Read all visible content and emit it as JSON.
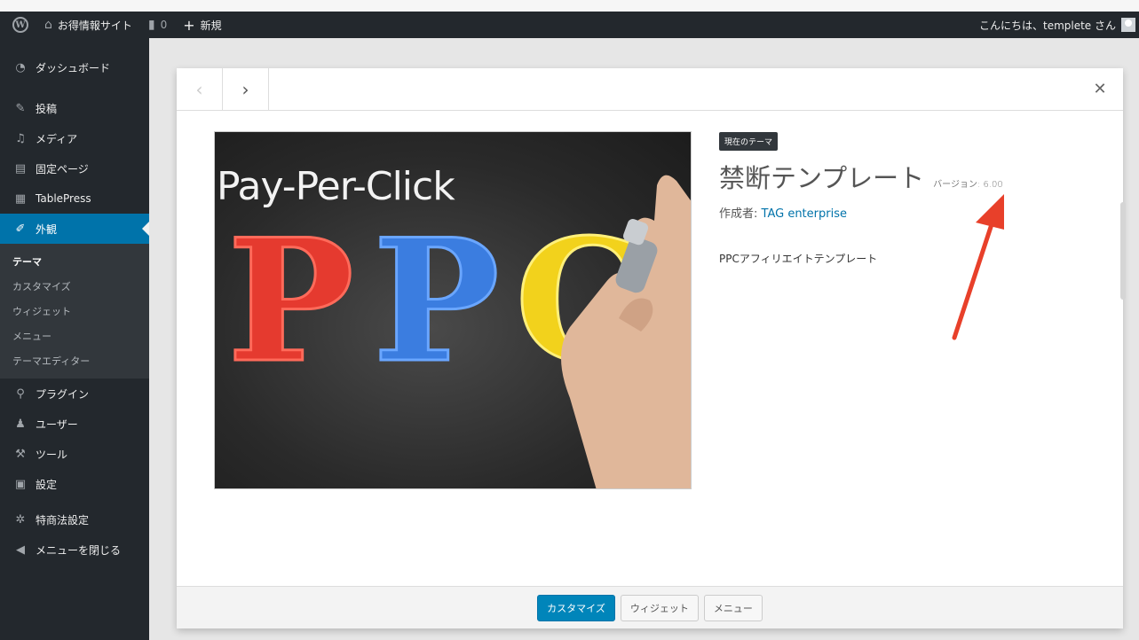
{
  "adminbar": {
    "site_name": "お得情報サイト",
    "comments_count": "0",
    "new_label": "新規",
    "greeting": "こんにちは、templete さん"
  },
  "sidebar": {
    "items": [
      {
        "label": "ダッシュボード",
        "icon": "dashboard-icon"
      },
      {
        "label": "投稿",
        "icon": "pin-icon"
      },
      {
        "label": "メディア",
        "icon": "media-icon"
      },
      {
        "label": "固定ページ",
        "icon": "page-icon"
      },
      {
        "label": "TablePress",
        "icon": "table-icon"
      },
      {
        "label": "外観",
        "icon": "paintbrush-icon",
        "active": true
      },
      {
        "label": "プラグイン",
        "icon": "plugin-icon"
      },
      {
        "label": "ユーザー",
        "icon": "user-icon"
      },
      {
        "label": "ツール",
        "icon": "wrench-icon"
      },
      {
        "label": "設定",
        "icon": "settings-icon"
      },
      {
        "label": "特商法設定",
        "icon": "gear-icon"
      },
      {
        "label": "メニューを閉じる",
        "icon": "collapse-icon"
      }
    ],
    "submenu": [
      "テーマ",
      "カスタマイズ",
      "ウィジェット",
      "メニュー",
      "テーマエディター"
    ]
  },
  "modal": {
    "screenshot_title": "Pay-Per-Click",
    "screenshot_letters": [
      "P",
      "P",
      "C"
    ],
    "badge": "現在のテーマ",
    "theme_name": "禁断テンプレート",
    "version_label": "バージョン: 6.00",
    "author_prefix": "作成者: ",
    "author_name": "TAG enterprise",
    "description": "PPCアフィリエイトテンプレート",
    "footer_buttons": [
      "カスタマイズ",
      "ウィジェット",
      "メニュー"
    ]
  },
  "colors": {
    "admin_bar": "#23282d",
    "accent": "#0073aa",
    "arrow": "#e8402a"
  }
}
